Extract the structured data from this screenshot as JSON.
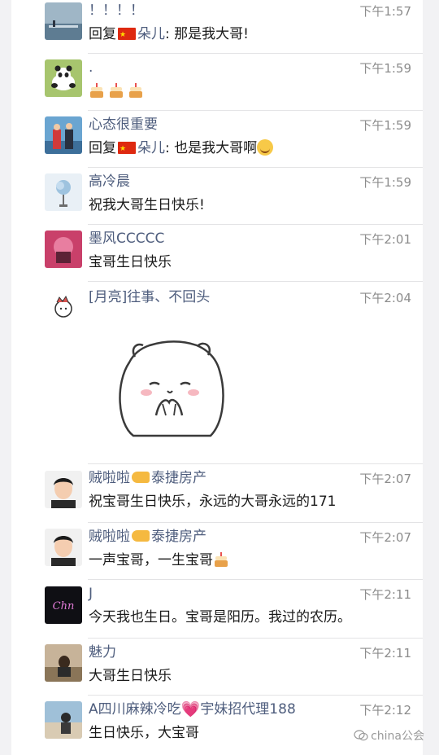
{
  "messages": [
    {
      "name": "！！！！",
      "time": "下午1:57",
      "reply_prefix": "回复",
      "reply_name": "朵儿",
      "text": ": 那是我大哥!"
    },
    {
      "name": ".",
      "time": "下午1:59",
      "text": ""
    },
    {
      "name": "心态很重要",
      "time": "下午1:59",
      "reply_prefix": "回复",
      "reply_name": "朵儿",
      "text": ": 也是我大哥啊"
    },
    {
      "name": "高冷晨",
      "time": "下午1:59",
      "text": "祝我大哥生日快乐!"
    },
    {
      "name": "墨风CCCCC",
      "time": "下午2:01",
      "text": "宝哥生日快乐"
    },
    {
      "name": "[月亮]往事、不回头",
      "time": "下午2:04",
      "text": ""
    },
    {
      "name_a": "贼啦啦",
      "name_b": "泰捷房产",
      "time": "下午2:07",
      "text": "祝宝哥生日快乐，永远的大哥永远的171"
    },
    {
      "name_a": "贼啦啦",
      "name_b": "泰捷房产",
      "time": "下午2:07",
      "text": "一声宝哥，一生宝哥"
    },
    {
      "name": "J",
      "time": "下午2:11",
      "text": "今天我也生日。宝哥是阳历。我过的农历。"
    },
    {
      "name": "魅力",
      "time": "下午2:11",
      "text": "大哥生日快乐"
    },
    {
      "name_a": "A四川麻辣冷吃",
      "name_b": "宇妹招代理188",
      "time": "下午2:12",
      "text": "生日快乐，大宝哥"
    }
  ],
  "icons": {
    "flag": "china-flag-icon",
    "cake": "birthday-cake-icon",
    "laugh": "laughing-face-icon",
    "point": "pointing-hand-icon",
    "heart": "pink-heart-icon"
  },
  "watermark": {
    "text": "china公会"
  },
  "colors": {
    "name": "#4e5d7d",
    "time": "#8c8c8c",
    "text": "#1a1a1a",
    "divider": "#e3e3e5"
  }
}
